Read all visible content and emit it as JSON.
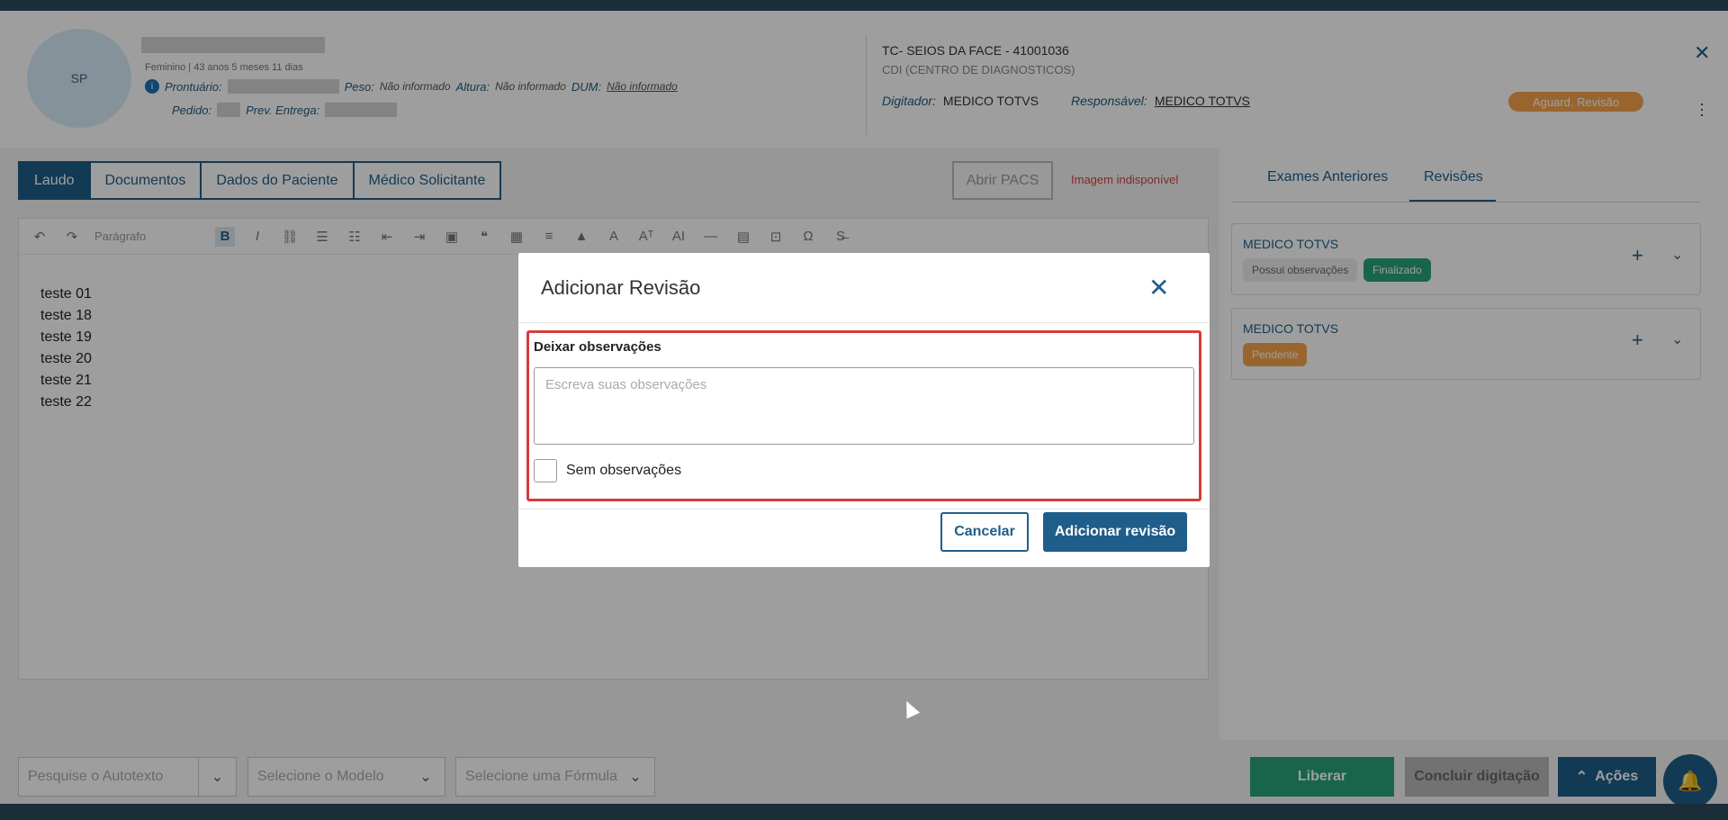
{
  "patient": {
    "avatar_initials": "SP",
    "demographics": "Feminino | 43 anos 5 meses 11 dias",
    "prontuario_label": "Prontuário:",
    "peso_label": "Peso:",
    "peso_value": "Não informado",
    "altura_label": "Altura:",
    "altura_value": "Não informado",
    "dum_label": "DUM:",
    "dum_value": "Não informado",
    "pedido_label": "Pedido:",
    "prev_entrega_label": "Prev. Entrega:"
  },
  "exam": {
    "title": "TC- SEIOS DA FACE - 41001036",
    "unit": "CDI (CENTRO DE DIAGNOSTICOS)",
    "digitador_label": "Digitador:",
    "digitador_value": "MEDICO TOTVS",
    "responsavel_label": "Responsável:",
    "responsavel_value": "MEDICO TOTVS",
    "status": "Aguard. Revisão"
  },
  "tabs": [
    {
      "label": "Laudo"
    },
    {
      "label": "Documentos"
    },
    {
      "label": "Dados do Paciente"
    },
    {
      "label": "Médico Solicitante"
    }
  ],
  "pacs": {
    "button": "Abrir PACS",
    "warning": "Imagem indisponível"
  },
  "editor": {
    "paragraph_style": "Parágrafo",
    "lines": [
      "teste 01",
      "teste 18",
      "teste 19",
      "teste 20",
      "teste 21",
      "teste 22"
    ]
  },
  "right_panel": {
    "tabs": [
      "Exames Anteriores",
      "Revisões"
    ],
    "reviews": [
      {
        "name": "MEDICO TOTVS",
        "chips": [
          "Possui observações",
          "Finalizado"
        ]
      },
      {
        "name": "MEDICO TOTVS",
        "chips": [
          "Pendente"
        ]
      }
    ]
  },
  "bottom": {
    "autotext_placeholder": "Pesquise o Autotexto",
    "model_placeholder": "Selecione o Modelo",
    "formula_placeholder": "Selecione uma Fórmula",
    "liberar": "Liberar",
    "concluir": "Concluir digitação",
    "acoes": "Ações"
  },
  "modal": {
    "title": "Adicionar Revisão",
    "obs_label": "Deixar observações",
    "obs_placeholder": "Escreva suas observações",
    "checkbox_label": "Sem observações",
    "cancel": "Cancelar",
    "submit": "Adicionar revisão"
  },
  "colors": {
    "primary": "#1f5e8a",
    "status_orange": "#f7a44c",
    "success_green": "#27a37a",
    "highlight_red": "#d93a3a"
  }
}
